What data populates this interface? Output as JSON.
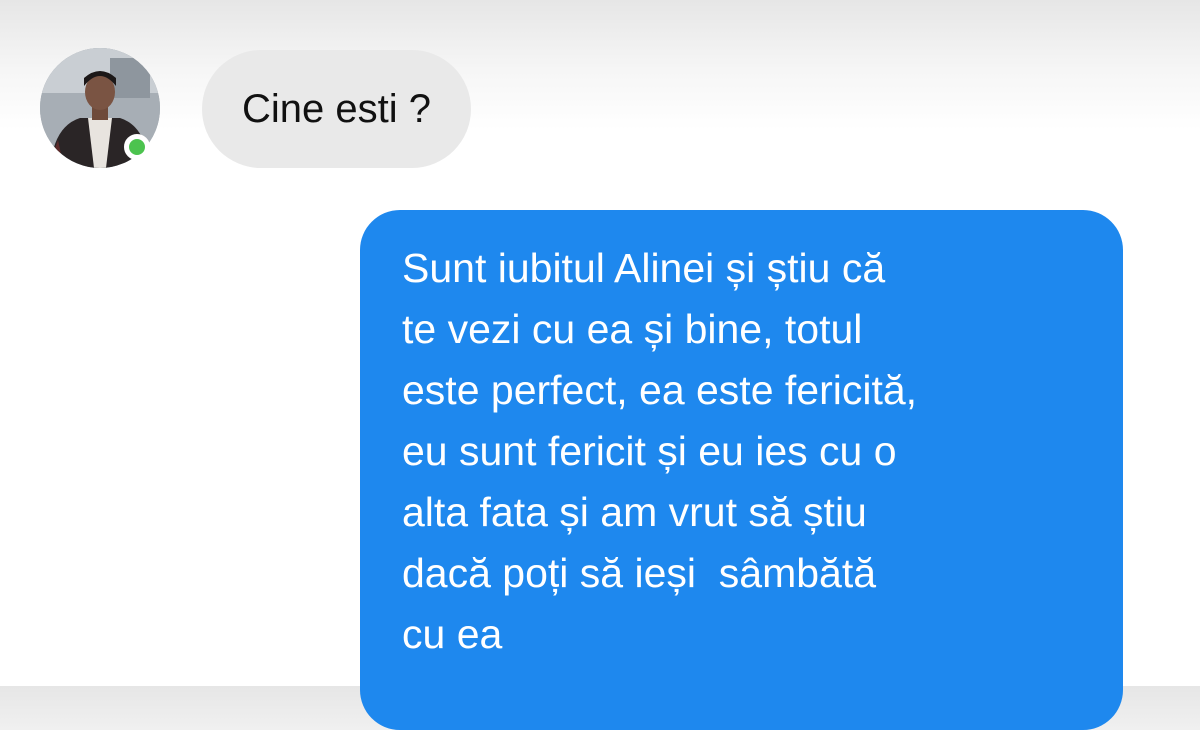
{
  "conversation": {
    "incoming": {
      "avatar_icon": "user-avatar",
      "presence": "online",
      "presence_color": "#4cc34f",
      "text": "Cine esti ?",
      "bubble_color": "#e9e9e9"
    },
    "outgoing": {
      "bubble_color": "#1e88ee",
      "lines": [
        "Sunt iubitul Alinei și știu că",
        "te vezi cu ea și bine, totul",
        "este perfect, ea este fericită,",
        "eu sunt fericit și eu ies cu o",
        "alta fata și am vrut să știu",
        "dacă poți să ieși  sâmbătă",
        "cu ea"
      ]
    }
  }
}
